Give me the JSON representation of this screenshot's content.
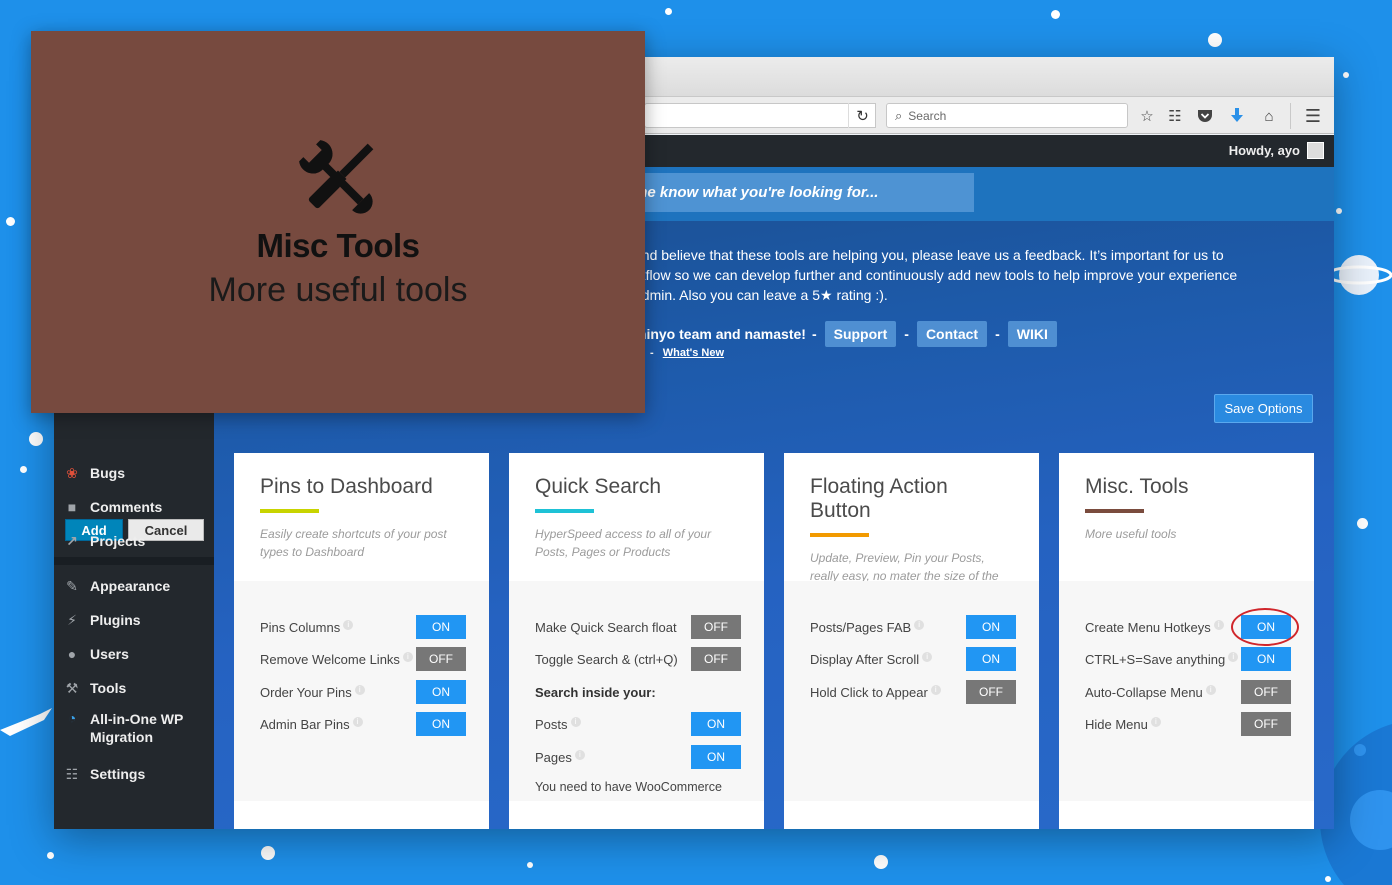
{
  "browser": {
    "search_placeholder": "Search",
    "icons": [
      "reload-icon",
      "star-icon",
      "reading-list-icon",
      "pocket-icon",
      "download-icon",
      "home-icon",
      "menu-icon"
    ]
  },
  "admin_bar": {
    "howdy": "Howdy, ayo"
  },
  "search_banner": {
    "text": "me know what you're looking for..."
  },
  "feedback": {
    "line1": "and believe that these tools are helping you, please leave us a feedback. It’s important for us to",
    "line2": "rkflow so we can develop further and continuously add new tools to help improve your experience",
    "line3": "admin. Also you can leave a 5★ rating :)."
  },
  "team_row": {
    "text": "minyo team and namaste!",
    "dash": "-",
    "support": "Support",
    "contact": "Contact",
    "wiki": "WIKI",
    "whats_new": "What's New"
  },
  "save_options": "Save Options",
  "sidebar": {
    "add": "Add",
    "cancel": "Cancel",
    "items": [
      {
        "label": "Bugs",
        "icon": "bug-icon"
      },
      {
        "label": "Comments",
        "icon": "comment-icon"
      },
      {
        "label": "Projects",
        "icon": "pin-icon"
      },
      {
        "label": "Appearance",
        "icon": "paintbrush-icon"
      },
      {
        "label": "Plugins",
        "icon": "plugin-icon"
      },
      {
        "label": "Users",
        "icon": "user-icon"
      },
      {
        "label": "Tools",
        "icon": "wrench-icon"
      },
      {
        "label": "All-in-One WP Migration",
        "icon": "migration-icon"
      },
      {
        "label": "Settings",
        "icon": "settings-icon"
      }
    ]
  },
  "cards": [
    {
      "title": "Pins to Dashboard",
      "accent": "#c8d400",
      "desc": "Easily create shortcuts of your post types to Dashboard",
      "options": [
        {
          "label": "Pins Columns",
          "state": "ON"
        },
        {
          "label": "Remove Welcome Links",
          "state": "OFF"
        },
        {
          "label": "Order Your Pins",
          "state": "ON"
        },
        {
          "label": "Admin Bar Pins",
          "state": "ON"
        }
      ]
    },
    {
      "title": "Quick Search",
      "accent": "#1ec2d6",
      "desc": "HyperSpeed access to all of your Posts, Pages or Products",
      "options": [
        {
          "label": "Make Quick Search float",
          "state": "OFF"
        },
        {
          "label": "Toggle Search & (ctrl+Q)",
          "state": "OFF"
        },
        {
          "label": "Posts",
          "state": "ON"
        },
        {
          "label": "Pages",
          "state": "ON"
        }
      ],
      "section_label": "Search inside your:",
      "note": "You need to have WooCommerce"
    },
    {
      "title": "Floating Action Button",
      "accent": "#f29a00",
      "desc": "Update, Preview, Pin your Posts, really easy, no mater the size of the Post",
      "options": [
        {
          "label": "Posts/Pages FAB",
          "state": "ON"
        },
        {
          "label": "Display After Scroll",
          "state": "ON"
        },
        {
          "label": "Hold Click to Appear",
          "state": "OFF"
        }
      ]
    },
    {
      "title": "Misc. Tools",
      "accent": "#7a4c3e",
      "desc": "More useful tools",
      "options": [
        {
          "label": "Create Menu Hotkeys",
          "state": "ON"
        },
        {
          "label": "CTRL+S=Save anything",
          "state": "ON"
        },
        {
          "label": "Auto-Collapse Menu",
          "state": "OFF"
        },
        {
          "label": "Hide Menu",
          "state": "OFF"
        }
      ]
    }
  ],
  "overlay": {
    "title": "Misc Tools",
    "subtitle": "More useful tools",
    "icon": "tools-icon",
    "bg": "#774a3f"
  },
  "colors": {
    "background": "#1e90ea",
    "toggle_on": "#2196f3",
    "toggle_off": "#777777",
    "highlight_circle": "#d0262b"
  }
}
